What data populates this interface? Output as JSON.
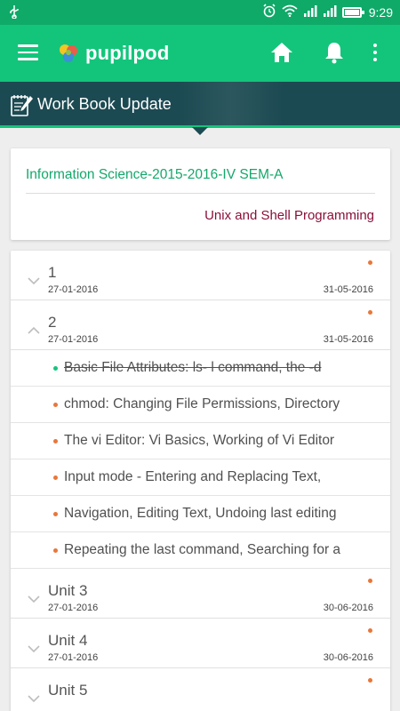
{
  "status_bar": {
    "time": "9:29",
    "battery_level": 1.0,
    "icons": [
      "usb-icon",
      "alarm-icon",
      "wifi-icon",
      "signal-icon",
      "signal-icon",
      "battery-icon"
    ]
  },
  "app_bar": {
    "title": "pupilpod",
    "icons": [
      "menu-icon",
      "pupilpod-logo",
      "home-icon",
      "bell-icon",
      "more-vert-icon"
    ]
  },
  "page_header": {
    "title": "Work Book Update",
    "icon": "notebook-icon"
  },
  "course_card": {
    "course": "Information Science-2015-2016-IV SEM-A",
    "subject": "Unix and Shell Programming",
    "colors": {
      "course": "#14a86b",
      "subject": "#8a0f3a"
    }
  },
  "units": [
    {
      "name": "1",
      "start": "27-01-2016",
      "end": "31-05-2016",
      "expanded": false
    },
    {
      "name": "2",
      "start": "27-01-2016",
      "end": "31-05-2016",
      "expanded": true,
      "topics": [
        {
          "text": "Basic File Attributes: ls- l command, the -d",
          "completed": true
        },
        {
          "text": "chmod: Changing File Permissions, Directory",
          "completed": false
        },
        {
          "text": "The vi Editor: Vi Basics, Working of Vi Editor",
          "completed": false
        },
        {
          "text": "Input mode - Entering and Replacing Text,",
          "completed": false
        },
        {
          "text": "Navigation, Editing Text, Undoing last editing",
          "completed": false
        },
        {
          "text": "Repeating the last command, Searching for a",
          "completed": false
        }
      ]
    },
    {
      "name": "Unit 3",
      "start": "27-01-2016",
      "end": "30-06-2016",
      "expanded": false
    },
    {
      "name": "Unit 4",
      "start": "27-01-2016",
      "end": "30-06-2016",
      "expanded": false
    },
    {
      "name": "Unit 5",
      "start": "",
      "end": "",
      "expanded": false
    }
  ],
  "colors": {
    "primary": "#13c57b",
    "status_bar": "#0fa968",
    "header": "#1c4a52",
    "pending_dot": "#e8773a",
    "done_dot": "#13c57b"
  }
}
